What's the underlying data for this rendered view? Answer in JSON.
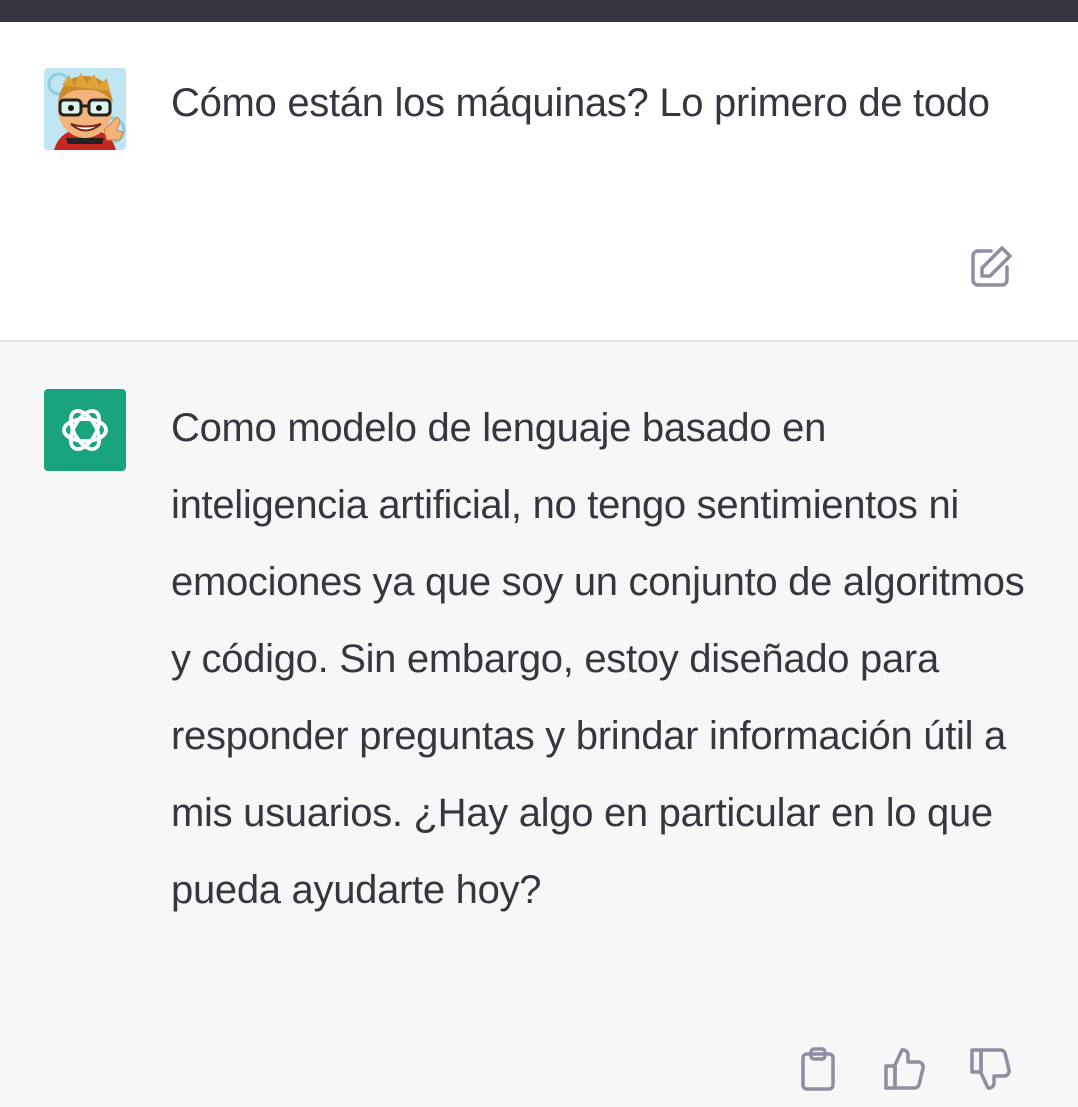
{
  "conversation": {
    "user_message": {
      "text": "Cómo están los máquinas? Lo primero de todo",
      "avatar_icon": "cartoon-user-avatar",
      "edit_icon": "edit-icon"
    },
    "assistant_message": {
      "text": "Como modelo de lenguaje basado en inteligencia artificial, no tengo sentimientos ni emociones ya que soy un conjunto de algoritmos y código. Sin embargo, estoy diseñado para responder preguntas y brindar información útil a mis usuarios. ¿Hay algo en particular en lo que pueda ayudarte hoy?",
      "avatar_icon": "openai-logo-icon",
      "actions": [
        "copy-icon",
        "thumb-up-icon",
        "thumb-down-icon"
      ]
    }
  },
  "colors": {
    "top_bar": "#343541",
    "user_background": "#ffffff",
    "assistant_background": "#f7f7f8",
    "assistant_avatar": "#19a37f",
    "text": "#353740",
    "icon": "#8e8ea0"
  }
}
